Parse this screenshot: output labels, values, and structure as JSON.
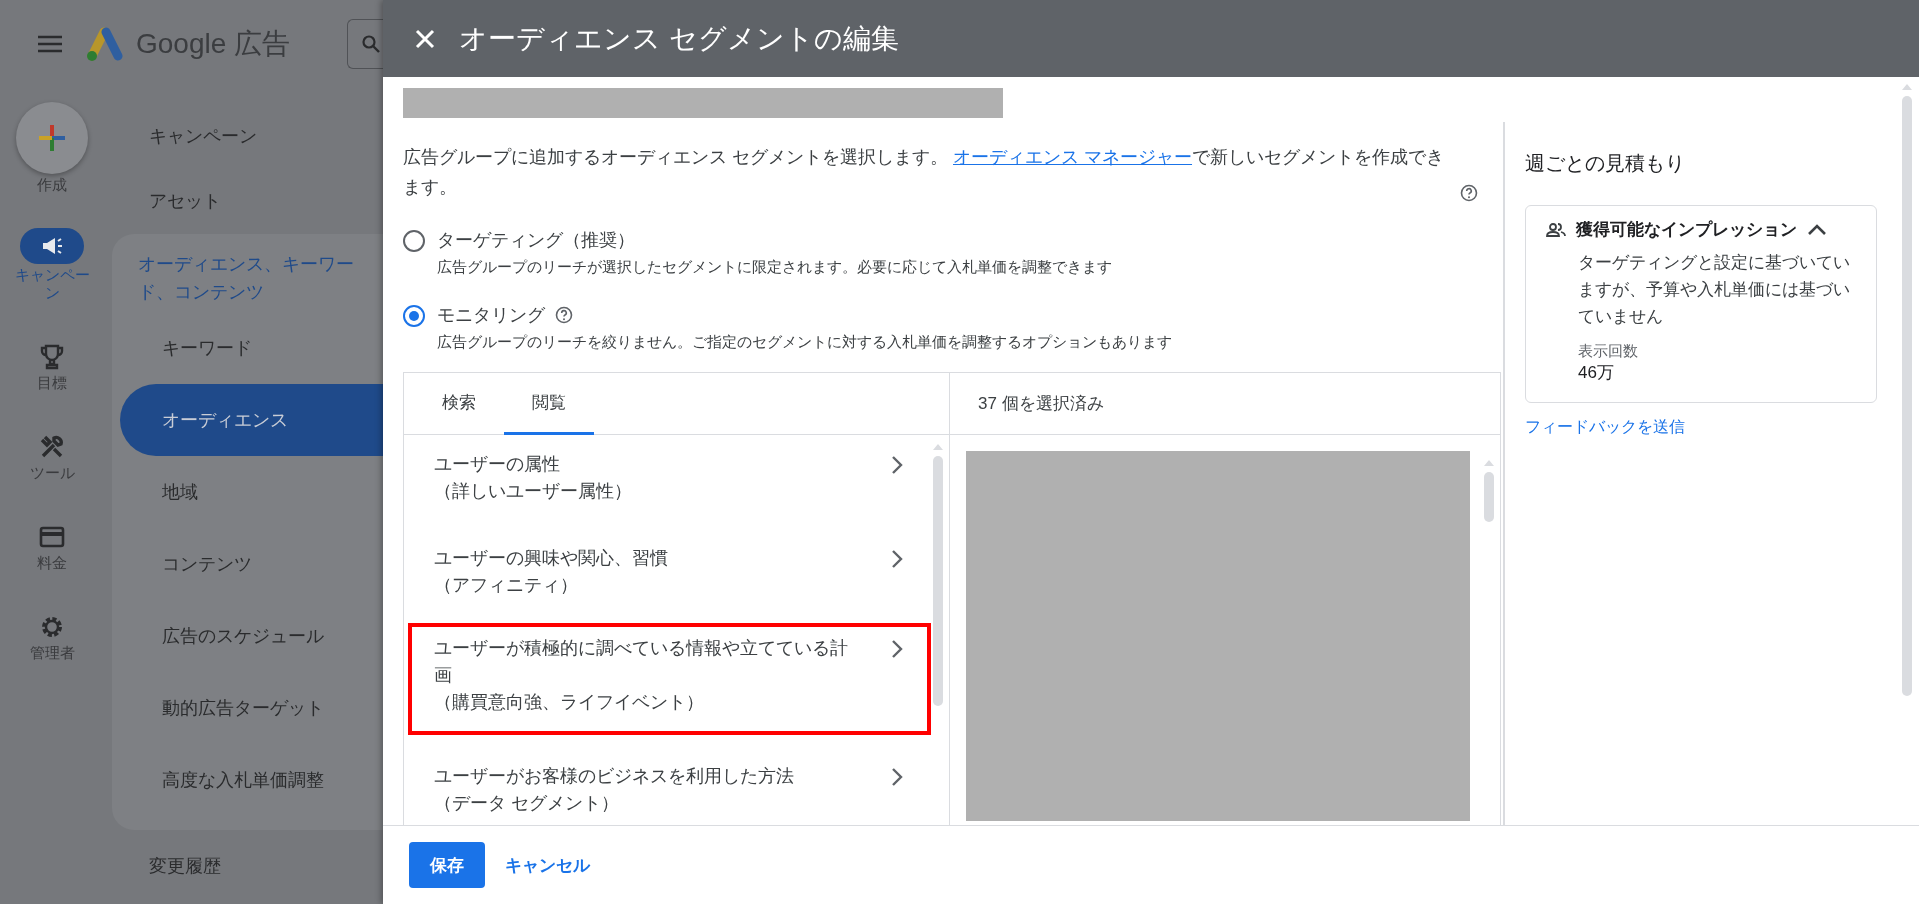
{
  "app": {
    "logo_text": "Google 広告"
  },
  "rail": [
    {
      "kind": "create",
      "label": "作成",
      "selected": false
    },
    {
      "kind": "campaign",
      "label": "キャンペーン",
      "selected": true
    },
    {
      "kind": "goals",
      "label": "目標",
      "selected": false
    },
    {
      "kind": "tools",
      "label": "ツール",
      "selected": false
    },
    {
      "kind": "billing",
      "label": "料金",
      "selected": false
    },
    {
      "kind": "admin",
      "label": "管理者",
      "selected": false
    }
  ],
  "nav": {
    "items": [
      {
        "label": "キャンペーン",
        "selected": false
      },
      {
        "label": "アセット",
        "selected": false
      }
    ],
    "group": {
      "label": "オーディエンス、キーワード、コンテンツ",
      "children": [
        {
          "label": "キーワード",
          "selected": false
        },
        {
          "label": "オーディエンス",
          "selected": true
        },
        {
          "label": "地域",
          "selected": false
        },
        {
          "label": "コンテンツ",
          "selected": false
        },
        {
          "label": "広告のスケジュール",
          "selected": false
        },
        {
          "label": "動的広告ターゲット",
          "selected": false
        },
        {
          "label": "高度な入札単価調整",
          "selected": false
        }
      ]
    },
    "footer_item": "変更履歴"
  },
  "dialog": {
    "title": "オーディエンス セグメントの編集",
    "intro": {
      "text": "広告グループに追加するオーディエンス セグメントを選択します。 ",
      "link": "オーディエンス マネージャー",
      "text_after": "で新しいセグメントを作成できます。"
    },
    "options": [
      {
        "label": "ターゲティング（推奨）",
        "description": "広告グループのリーチが選択したセグメントに限定されます。必要に応じて入札単価を調整できます",
        "selected": false,
        "help": false
      },
      {
        "label": "モニタリング",
        "description": "広告グループのリーチを絞りません。ご指定のセグメントに対する入札単価を調整するオプションもあります",
        "selected": true,
        "help": true
      }
    ],
    "tabs": [
      {
        "label": "検索",
        "selected": false
      },
      {
        "label": "閲覧",
        "selected": true
      }
    ],
    "categories": [
      {
        "title": "ユーザーの属性",
        "subtitle": "（詳しいユーザー属性）",
        "highlighted": false
      },
      {
        "title": "ユーザーの興味や関心、習慣",
        "subtitle": "（アフィニティ）",
        "highlighted": false
      },
      {
        "title": "ユーザーが積極的に調べている情報や立てている計画",
        "subtitle": "（購買意向強、ライフイベント）",
        "highlighted": true
      },
      {
        "title": "ユーザーがお客様のビジネスを利用した方法",
        "subtitle": "（データ セグメント）",
        "highlighted": false
      }
    ],
    "selected_count": "37 個を選択済み",
    "estimate": {
      "heading": "週ごとの見積もり",
      "card": {
        "title": "獲得可能なインプレッション",
        "expanded": true,
        "description": "ターゲティングと設定に基づいていますが、予算や入札単価には基づいていません",
        "metric_label": "表示回数",
        "metric_value": "46万"
      },
      "feedback_link": "フィードバックを送信"
    },
    "footer": {
      "save": "保存",
      "cancel": "キャンセル"
    }
  }
}
